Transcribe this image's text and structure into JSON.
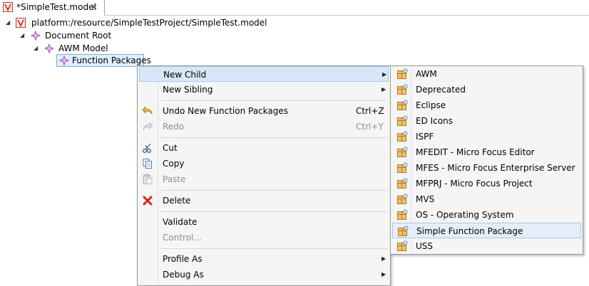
{
  "editor_tab": {
    "title": "*SimpleTest.model",
    "close_glyph": "✕",
    "icon": "model-file-icon"
  },
  "tree": {
    "resource": "platform:/resource/SimpleTestProject/SimpleTest.model",
    "document_root": "Document Root",
    "awm_model": "AWM Model",
    "function_packages": "Function Packages",
    "expander_glyph": "◢"
  },
  "context_menu": {
    "new_child": "New Child",
    "new_sibling": "New Sibling",
    "undo": "Undo New Function Packages",
    "undo_accel": "Ctrl+Z",
    "redo": "Redo",
    "redo_accel": "Ctrl+Y",
    "cut": "Cut",
    "copy": "Copy",
    "paste": "Paste",
    "delete": "Delete",
    "validate": "Validate",
    "control": "Control...",
    "profile_as": "Profile As",
    "debug_as": "Debug As",
    "submenu_arrow": "▶"
  },
  "submenu": {
    "items": [
      "AWM",
      "Deprecated",
      "Eclipse",
      "ED Icons",
      "ISPF",
      "MFEDIT - Micro Focus Editor",
      "MFES - Micro Focus Enterprise Server",
      "MFPRJ - Micro Focus Project",
      "MVS",
      "OS - Operating System",
      "Simple Function Package",
      "USS"
    ],
    "highlighted": "Simple Function Package"
  },
  "colors": {
    "hover": "#d6e7f8",
    "selection": "#ddeeff",
    "menu_bg": "#f5f5f5",
    "delete_red": "#d9261c",
    "node_purple": "#9a4fb5",
    "model_red": "#c0392b"
  }
}
